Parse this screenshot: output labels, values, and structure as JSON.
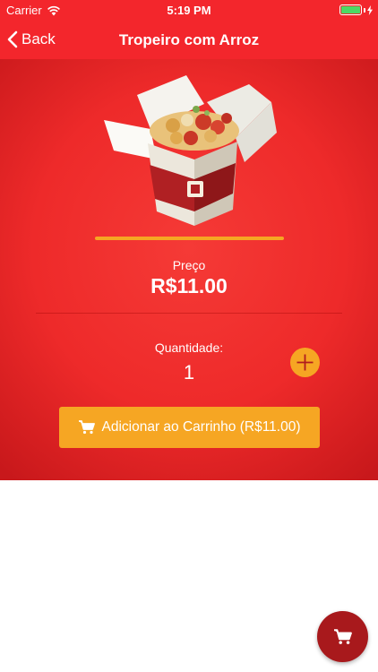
{
  "status_bar": {
    "carrier": "Carrier",
    "time": "5:19 PM",
    "icons": [
      "wifi-icon",
      "battery-icon",
      "charging-icon"
    ]
  },
  "nav": {
    "back_label": "Back",
    "title": "Tropeiro com Arroz"
  },
  "product": {
    "price_label": "Preço",
    "price_value": "R$11.00",
    "quantity_label": "Quantidade:",
    "quantity_value": "1",
    "add_to_cart_label": "Adicionar ao Carrinho (R$11.00)"
  },
  "colors": {
    "primary_red": "#f3262c",
    "accent_orange": "#f6a623",
    "fab_dark_red": "#a8191c"
  }
}
